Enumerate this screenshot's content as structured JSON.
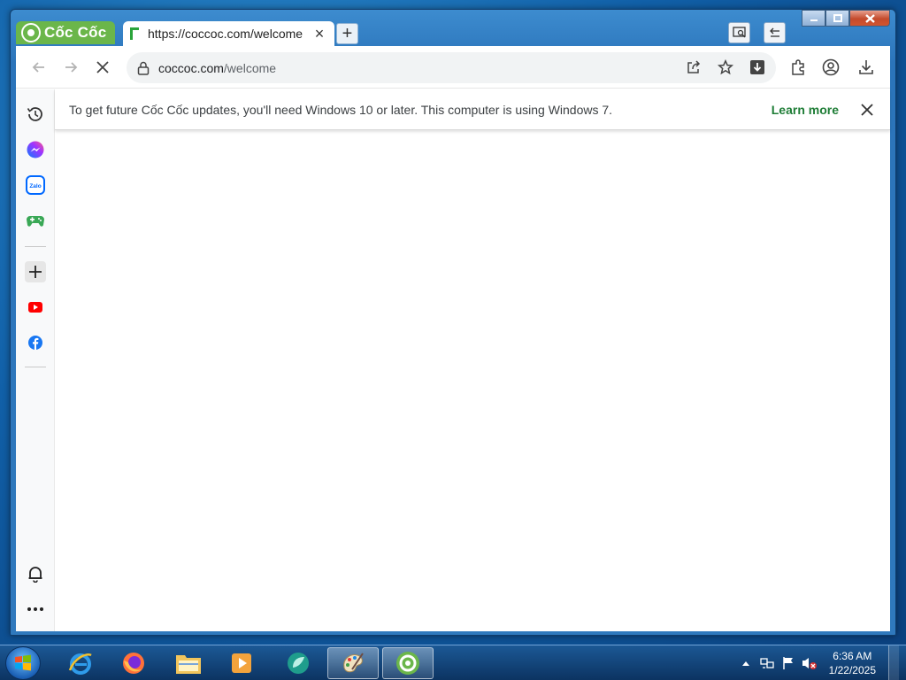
{
  "browser": {
    "brand_name": "Cốc Cốc",
    "tab": {
      "title": "https://coccoc.com/welcome",
      "close": "×"
    },
    "new_tab_label": "+",
    "address": {
      "host": "coccoc.com",
      "path": "/welcome"
    }
  },
  "infobar": {
    "message": "To get future Cốc Cốc updates, you'll need Windows 10 or later. This computer is using Windows 7.",
    "link": "Learn more"
  },
  "sidebar": {
    "items": [
      "history-icon",
      "messenger-icon",
      "zalo-icon",
      "games-icon",
      "add-icon",
      "youtube-icon",
      "facebook-icon",
      "notifications-icon",
      "more-icon"
    ]
  },
  "taskbar": {
    "apps": [
      "internet-explorer-icon",
      "firefox-icon",
      "file-explorer-icon",
      "media-player-icon",
      "app-icon",
      "paint-icon",
      "coccoc-icon"
    ],
    "clock": {
      "time": "6:36 AM",
      "date": "1/22/2025"
    }
  },
  "colors": {
    "accent": "#6bb64a",
    "link": "#1e7d36",
    "taskbar": "#1a5a96"
  }
}
